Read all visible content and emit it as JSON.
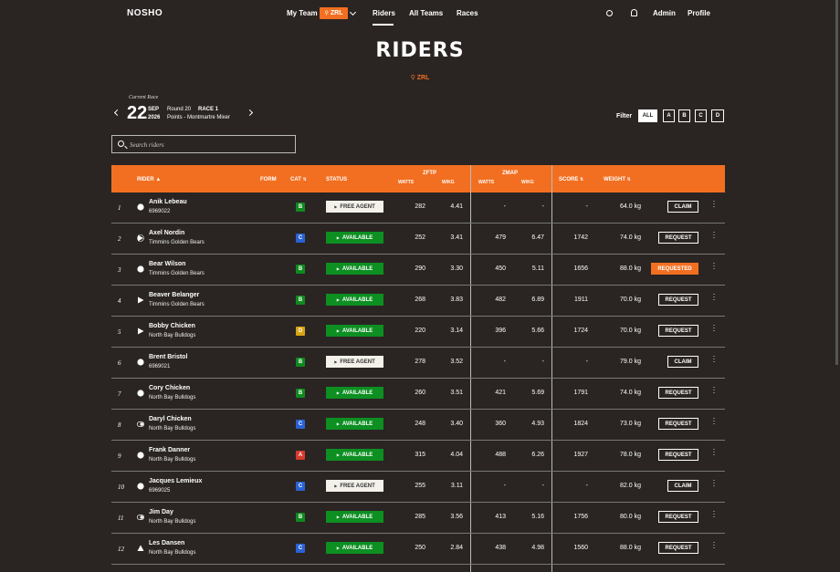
{
  "nav": {
    "brand": "NOSHO",
    "my_team": "My Team",
    "team_badge": "ZRL",
    "riders": "Riders",
    "all_teams": "All Teams",
    "races": "Races",
    "admin": "Admin",
    "profile": "Profile"
  },
  "page": {
    "title": "RIDERS",
    "subtitle": "ZRL"
  },
  "current_race": {
    "label": "Current Race",
    "day": "22",
    "month": "SEP",
    "year": "2026",
    "round": "Round 20",
    "race": "RACE 1",
    "event": "Points - Montmartre Mixer"
  },
  "filter": {
    "label": "Filter",
    "options": [
      "ALL",
      "A",
      "B",
      "C",
      "D"
    ],
    "selected": "ALL"
  },
  "search": {
    "placeholder": "Search riders"
  },
  "table": {
    "headers": {
      "rider": "RIDER",
      "form": "FORM",
      "cat": "CAT",
      "status": "STATUS",
      "zftp": "ZFTP",
      "zmap": "ZMAP",
      "watts": "WATTS",
      "wkg": "W/KG",
      "score": "SCORE",
      "weight": "WEIGHT"
    },
    "rows": [
      {
        "rank": "1",
        "form": "circle",
        "name": "Anik Lebeau",
        "sub": "6969022",
        "cat": "B",
        "status": "FREE AGENT",
        "ftp_watts": "282",
        "ftp_wkg": "4.41",
        "map_watts": "-",
        "map_wkg": "-",
        "score": "-",
        "weight": "64.0 kg",
        "action": "CLAIM"
      },
      {
        "rank": "2",
        "form": "play-circle",
        "name": "Axel Nordin",
        "sub": "Timmins Golden Bears",
        "cat": "C",
        "status": "AVAILABLE",
        "ftp_watts": "252",
        "ftp_wkg": "3.41",
        "map_watts": "479",
        "map_wkg": "6.47",
        "score": "1742",
        "weight": "74.0 kg",
        "action": "REQUEST"
      },
      {
        "rank": "3",
        "form": "circle",
        "name": "Bear Wilson",
        "sub": "Timmins Golden Bears",
        "cat": "B",
        "status": "AVAILABLE",
        "ftp_watts": "290",
        "ftp_wkg": "3.30",
        "map_watts": "450",
        "map_wkg": "5.11",
        "score": "1656",
        "weight": "88.0 kg",
        "action": "REQUESTED"
      },
      {
        "rank": "4",
        "form": "play",
        "name": "Beaver Belanger",
        "sub": "Timmins Golden Bears",
        "cat": "B",
        "status": "AVAILABLE",
        "ftp_watts": "268",
        "ftp_wkg": "3.83",
        "map_watts": "482",
        "map_wkg": "6.89",
        "score": "1911",
        "weight": "70.0 kg",
        "action": "REQUEST"
      },
      {
        "rank": "5",
        "form": "play",
        "name": "Bobby Chicken",
        "sub": "North Bay Bulldogs",
        "cat": "D",
        "status": "AVAILABLE",
        "ftp_watts": "220",
        "ftp_wkg": "3.14",
        "map_watts": "396",
        "map_wkg": "5.66",
        "score": "1724",
        "weight": "70.0 kg",
        "action": "REQUEST"
      },
      {
        "rank": "6",
        "form": "circle",
        "name": "Brent Bristol",
        "sub": "6969021",
        "cat": "B",
        "status": "FREE AGENT",
        "ftp_watts": "278",
        "ftp_wkg": "3.52",
        "map_watts": "-",
        "map_wkg": "-",
        "score": "-",
        "weight": "79.0 kg",
        "action": "CLAIM"
      },
      {
        "rank": "7",
        "form": "circle",
        "name": "Cory Chicken",
        "sub": "North Bay Bulldogs",
        "cat": "B",
        "status": "AVAILABLE",
        "ftp_watts": "260",
        "ftp_wkg": "3.51",
        "map_watts": "421",
        "map_wkg": "5.69",
        "score": "1791",
        "weight": "74.0 kg",
        "action": "REQUEST"
      },
      {
        "rank": "8",
        "form": "toggle",
        "name": "Daryl Chicken",
        "sub": "North Bay Bulldogs",
        "cat": "C",
        "status": "AVAILABLE",
        "ftp_watts": "248",
        "ftp_wkg": "3.40",
        "map_watts": "360",
        "map_wkg": "4.93",
        "score": "1824",
        "weight": "73.0 kg",
        "action": "REQUEST"
      },
      {
        "rank": "9",
        "form": "circle",
        "name": "Frank Danner",
        "sub": "North Bay Bulldogs",
        "cat": "A",
        "status": "AVAILABLE",
        "ftp_watts": "315",
        "ftp_wkg": "4.04",
        "map_watts": "488",
        "map_wkg": "6.26",
        "score": "1927",
        "weight": "78.0 kg",
        "action": "REQUEST"
      },
      {
        "rank": "10",
        "form": "circle",
        "name": "Jacques Lemieux",
        "sub": "6969025",
        "cat": "C",
        "status": "FREE AGENT",
        "ftp_watts": "255",
        "ftp_wkg": "3.11",
        "map_watts": "-",
        "map_wkg": "-",
        "score": "-",
        "weight": "82.0 kg",
        "action": "CLAIM"
      },
      {
        "rank": "11",
        "form": "toggle",
        "name": "Jim Day",
        "sub": "North Bay Bulldogs",
        "cat": "B",
        "status": "AVAILABLE",
        "ftp_watts": "285",
        "ftp_wkg": "3.56",
        "map_watts": "413",
        "map_wkg": "5.16",
        "score": "1756",
        "weight": "80.0 kg",
        "action": "REQUEST"
      },
      {
        "rank": "12",
        "form": "triangle",
        "name": "Les Dansen",
        "sub": "North Bay Bulldogs",
        "cat": "C",
        "status": "AVAILABLE",
        "ftp_watts": "250",
        "ftp_wkg": "2.84",
        "map_watts": "438",
        "map_wkg": "4.98",
        "score": "1560",
        "weight": "88.0 kg",
        "action": "REQUEST"
      }
    ]
  },
  "colors": {
    "accent": "#f26f21",
    "available": "#0d8f22",
    "cat_A": "#d83a2e",
    "cat_B": "#0f8a1f",
    "cat_C": "#2a62d6",
    "cat_D": "#d9a414"
  }
}
